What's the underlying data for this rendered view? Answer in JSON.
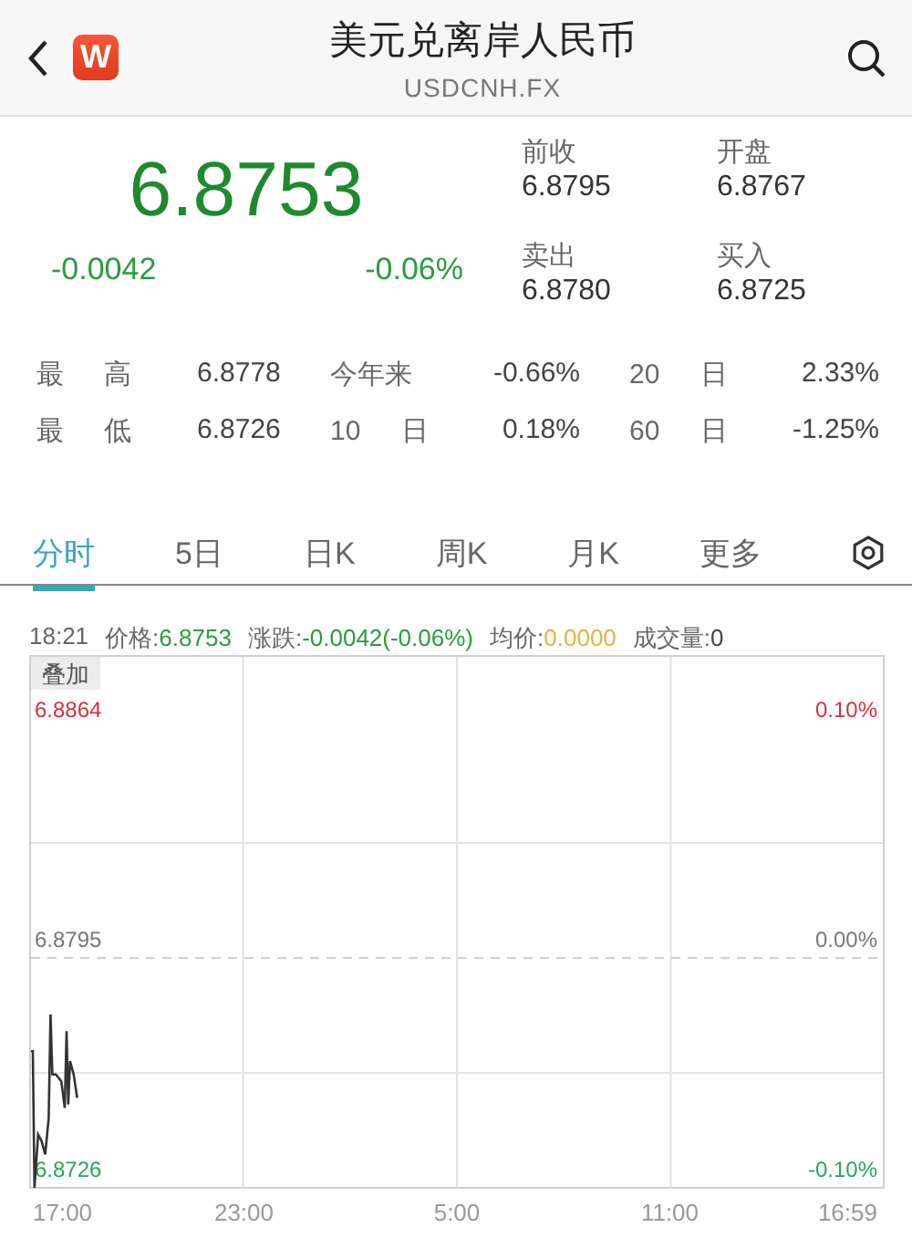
{
  "header": {
    "title": "美元兑离岸人民币",
    "subtitle": "USDCNH.FX",
    "logo": "W"
  },
  "quote": {
    "price": "6.8753",
    "change": "-0.0042",
    "change_percent": "-0.06%"
  },
  "quote_fields": [
    {
      "label": "前收",
      "value": "6.8795"
    },
    {
      "label": "开盘",
      "value": "6.8767"
    },
    {
      "label": "卖出",
      "value": "6.8780"
    },
    {
      "label": "买入",
      "value": "6.8725"
    }
  ],
  "stats": [
    [
      {
        "label": "最 高",
        "value": "6.8778"
      },
      {
        "label": "今年来",
        "value": "-0.66%"
      },
      {
        "label": "20 日",
        "value": "2.33%"
      }
    ],
    [
      {
        "label": "最 低",
        "value": "6.8726"
      },
      {
        "label": "10 日",
        "value": "0.18%"
      },
      {
        "label": "60 日",
        "value": "-1.25%"
      }
    ]
  ],
  "tabs": [
    {
      "label": "分时",
      "selected": true
    },
    {
      "label": "5日",
      "selected": false
    },
    {
      "label": "日K",
      "selected": false
    },
    {
      "label": "周K",
      "selected": false
    },
    {
      "label": "月K",
      "selected": false
    },
    {
      "label": "更多",
      "selected": false
    }
  ],
  "info_line": {
    "time": "18:21",
    "items": [
      {
        "label": "价格:",
        "value": "6.8753",
        "color": "#2e9a3e"
      },
      {
        "label": "涨跌:",
        "value": "-0.0042(-0.06%)",
        "color": "#2e9a3e"
      },
      {
        "label": "均价:",
        "value": "0.0000",
        "color": "#e8b04a"
      },
      {
        "label": "成交量:",
        "value": "0",
        "color": "#444444"
      }
    ]
  },
  "chart": {
    "overlay_button": "叠加",
    "left_labels": [
      "6.8864",
      "6.8795",
      "6.8726"
    ],
    "right_labels": [
      "0.10%",
      "0.00%",
      "-0.10%"
    ],
    "x_labels": [
      "17:00",
      "23:00",
      "5:00",
      "11:00",
      "16:59"
    ]
  }
}
